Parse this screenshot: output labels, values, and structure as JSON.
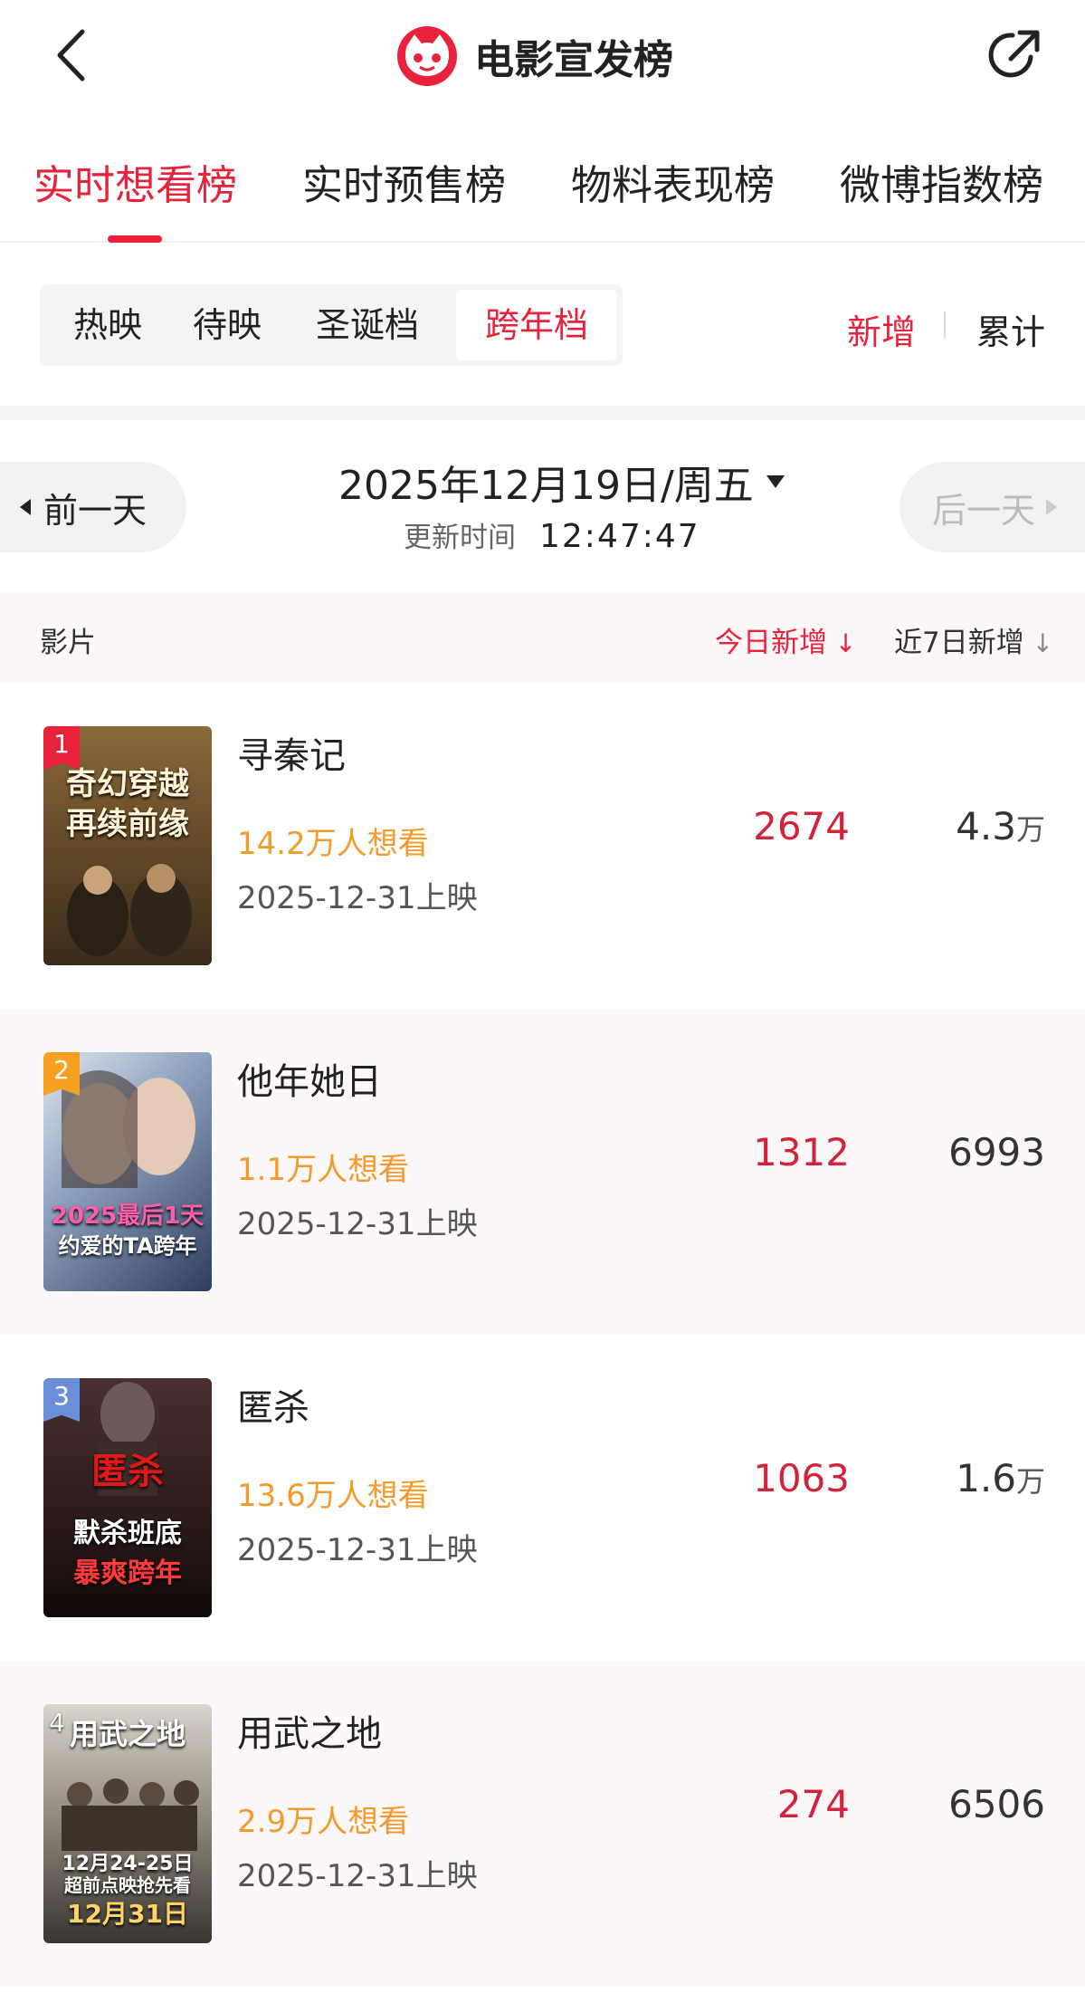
{
  "header": {
    "title": "电影宣发榜",
    "back_icon": "chevron-left-icon",
    "share_icon": "share-icon",
    "logo_icon": "maoyan-cat-logo"
  },
  "main_tabs": [
    {
      "label": "实时想看榜",
      "active": true
    },
    {
      "label": "实时预售榜",
      "active": false
    },
    {
      "label": "物料表现榜",
      "active": false
    },
    {
      "label": "微博指数榜",
      "active": false
    }
  ],
  "sub_tabs": [
    {
      "label": "热映",
      "active": false
    },
    {
      "label": "待映",
      "active": false
    },
    {
      "label": "圣诞档",
      "active": false
    },
    {
      "label": "跨年档",
      "active": true
    }
  ],
  "mode_toggle": {
    "new": "新增",
    "total": "累计",
    "active": "新增"
  },
  "date_nav": {
    "prev": "前一天",
    "next": "后一天",
    "date": "2025年12月19日/周五",
    "update_label": "更新时间",
    "update_time": "12:47:47"
  },
  "table": {
    "col_film": "影片",
    "col_today": "今日新增",
    "col_week": "近7日新增",
    "sort_icon": "sort-down-icon"
  },
  "films": [
    {
      "rank": "1",
      "name": "寻秦记",
      "want": "14.2万人想看",
      "release": "2025-12-31上映",
      "today": "2674",
      "week": "4.3",
      "week_unit": "万",
      "poster_line1": "奇幻穿越",
      "poster_line2": "再续前缘"
    },
    {
      "rank": "2",
      "name": "他年她日",
      "want": "1.1万人想看",
      "release": "2025-12-31上映",
      "today": "1312",
      "week": "6993",
      "week_unit": "",
      "poster_line1": "2025最后1天",
      "poster_line2": "约爱的TA跨年"
    },
    {
      "rank": "3",
      "name": "匿杀",
      "want": "13.6万人想看",
      "release": "2025-12-31上映",
      "today": "1063",
      "week": "1.6",
      "week_unit": "万",
      "poster_line1": "匿杀",
      "poster_line2": "默杀班底",
      "poster_line3": "暴爽跨年"
    },
    {
      "rank": "4",
      "name": "用武之地",
      "want": "2.9万人想看",
      "release": "2025-12-31上映",
      "today": "274",
      "week": "6506",
      "week_unit": "",
      "poster_line1": "用武之地",
      "poster_line2": "12月24-25日",
      "poster_line3": "超前点映抢先看",
      "poster_line4": "12月31日"
    }
  ],
  "colors": {
    "accent": "#e8223a",
    "want_orange": "#f39a2b",
    "rank1": "#e8223a",
    "rank2": "#f5a11f",
    "rank3": "#6a8fd8"
  }
}
